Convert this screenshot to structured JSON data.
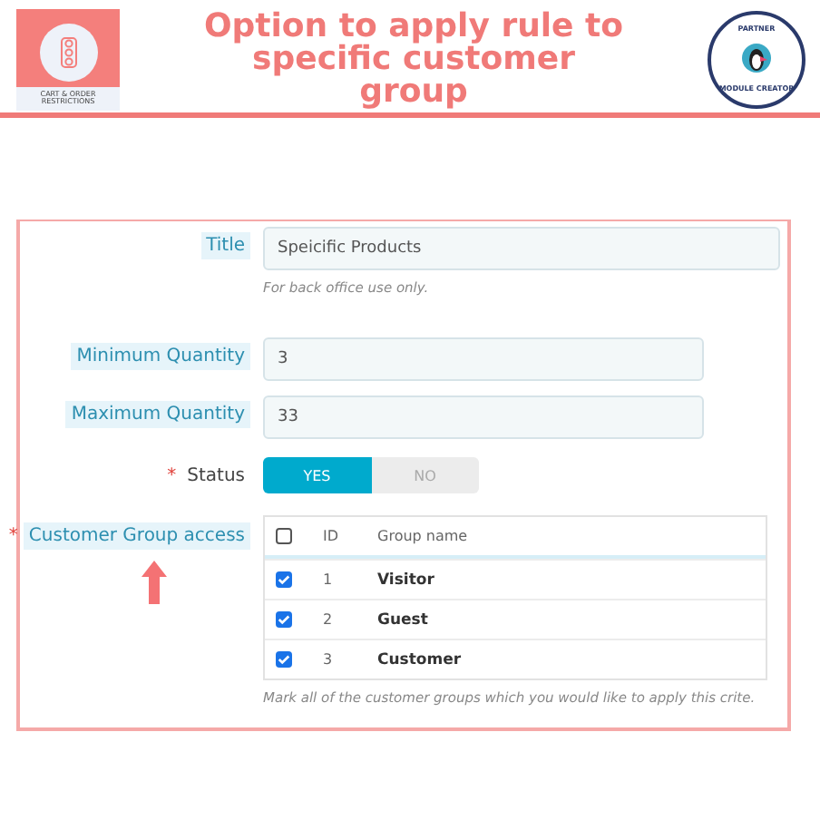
{
  "header": {
    "logo_caption": "CART & ORDER RESTRICTIONS",
    "title": "Option to apply rule to specific customer group",
    "badge_top": "PARTNER",
    "badge_bottom": "MODULE CREATOR"
  },
  "form": {
    "fields": [
      {
        "kind": "wide-text",
        "label": "Title",
        "value": "Speicific Products",
        "help": "For back office use only."
      },
      {
        "kind": "text",
        "label": "Minimum Quantity",
        "value": "3"
      },
      {
        "kind": "text",
        "label": "Maximum Quantity",
        "value": "33"
      },
      {
        "kind": "switch",
        "label": "Status",
        "required_mark": "*",
        "options": [
          {
            "label": "YES",
            "selected": true
          },
          {
            "label": "NO",
            "selected": false
          }
        ]
      },
      {
        "kind": "groups",
        "label": "Customer Group access",
        "required_mark": "*",
        "arrow": true,
        "columns": [
          "ID",
          "Group name"
        ],
        "all_checked": false,
        "rows": [
          {
            "id": "1",
            "name": "Visitor",
            "checked": true
          },
          {
            "id": "2",
            "name": "Guest",
            "checked": true
          },
          {
            "id": "3",
            "name": "Customer",
            "checked": true
          }
        ],
        "help": "Mark all of the customer groups which you would like to apply this crite."
      }
    ]
  }
}
